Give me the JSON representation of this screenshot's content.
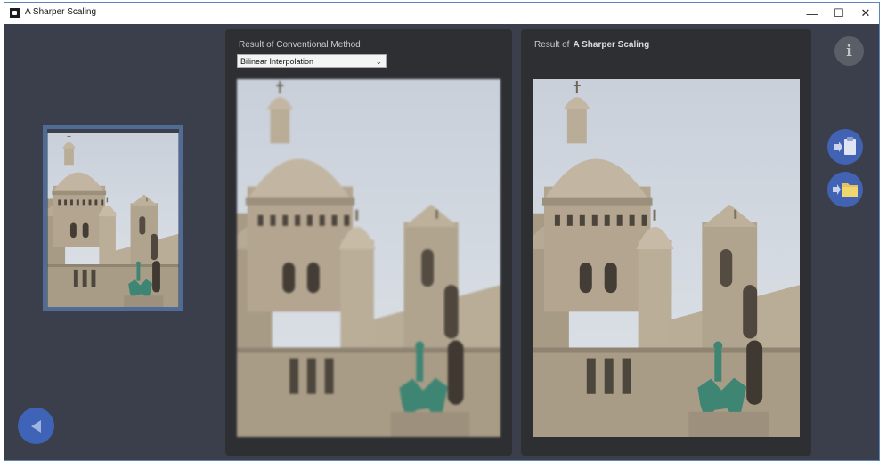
{
  "window": {
    "title": "A Sharper Scaling",
    "controls": {
      "minimize": "—",
      "maximize": "☐",
      "close": "✕"
    }
  },
  "panels": {
    "conventional": {
      "title": "Result of Conventional Method",
      "method_select": {
        "value": "Bilinear Interpolation"
      }
    },
    "sharper": {
      "title_prefix": "Result of",
      "title_emphasis": "A Sharper Scaling"
    }
  },
  "buttons": {
    "info": {
      "icon": "info-icon",
      "glyph": "i"
    },
    "clipboard": {
      "icon": "clipboard-arrow-icon"
    },
    "folder": {
      "icon": "folder-arrow-icon"
    },
    "back": {
      "icon": "back-arrow-icon"
    }
  },
  "colors": {
    "background": "#3a3f4b",
    "panel": "#2d2f33",
    "accent_button": "#4263b4",
    "selector_frame": "#4f6c96"
  }
}
